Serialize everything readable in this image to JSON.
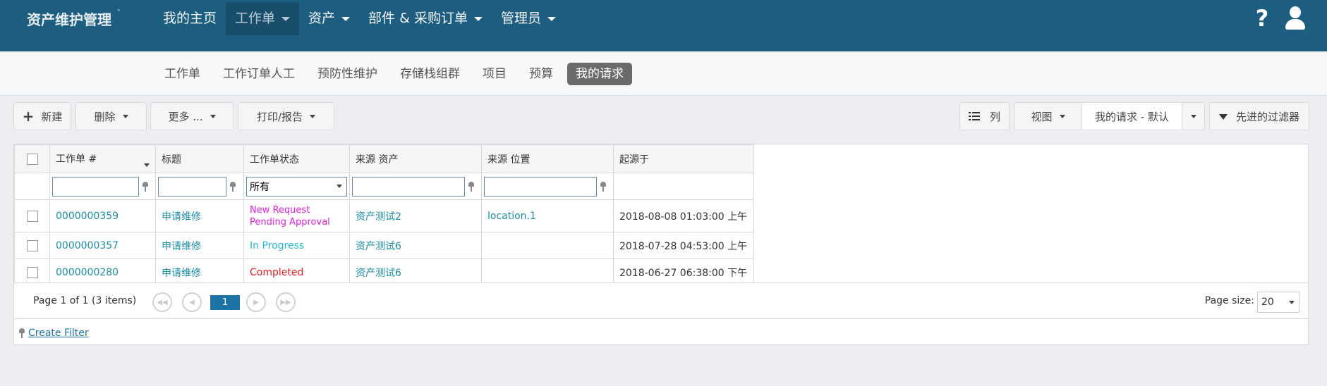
{
  "app": {
    "brand": "资产维护管理",
    "brand_mark": "`"
  },
  "topnav": [
    {
      "label": "我的主页",
      "caret": false,
      "active": false
    },
    {
      "label": "工作单",
      "caret": true,
      "active": true
    },
    {
      "label": "资产",
      "caret": true,
      "active": false
    },
    {
      "label": "部件 & 采购订单",
      "caret": true,
      "active": false
    },
    {
      "label": "管理员",
      "caret": true,
      "active": false
    }
  ],
  "top_right": {
    "help_symbol": "?"
  },
  "subnav": [
    "工作单",
    "工作订单人工",
    "预防性维护",
    "存储栈组群",
    "项目",
    "预算",
    "我的请求"
  ],
  "subnav_active": "我的请求",
  "toolbar": {
    "new_label": "新建",
    "delete_label": "删除",
    "more_label": "更多 ...",
    "print_label": "打印/报告",
    "columns_label": "列",
    "view_label": "视图",
    "view_value": "我的请求 - 默认",
    "advanced_filter_label": "先进的过滤器"
  },
  "table": {
    "headers": [
      "工作单 #",
      "标题",
      "工作单状态",
      "来源 资产",
      "来源 位置",
      "起源于"
    ],
    "status_filter_value": "所有",
    "rows": [
      {
        "id": "0000000359",
        "title": "申请维修",
        "status_line1": "New Request",
        "status_line2": "Pending Approval",
        "status_color": "#e020e0",
        "asset": "资产测试2",
        "location": "location.1",
        "origin": "2018-08-08 01:03:00 上午"
      },
      {
        "id": "0000000357",
        "title": "申请维修",
        "status_line1": "In Progress",
        "status_line2": "",
        "status_color": "#26b8dc",
        "asset": "资产测试6",
        "location": "",
        "origin": "2018-07-28 04:53:00 上午"
      },
      {
        "id": "0000000280",
        "title": "申请维修",
        "status_line1": "Completed",
        "status_line2": "",
        "status_color": "#e81c1c",
        "asset": "资产测试6",
        "location": "",
        "origin": "2018-06-27 06:38:00 下午"
      }
    ]
  },
  "pager": {
    "info": "Page 1 of 1 (3 items)",
    "current_page": "1",
    "page_size_label": "Page size:",
    "page_size": "20"
  },
  "create_filter_label": "Create Filter",
  "colors": {
    "topbar": "#1d5d80",
    "link": "#1a8da6",
    "accent": "#1d73a5"
  }
}
